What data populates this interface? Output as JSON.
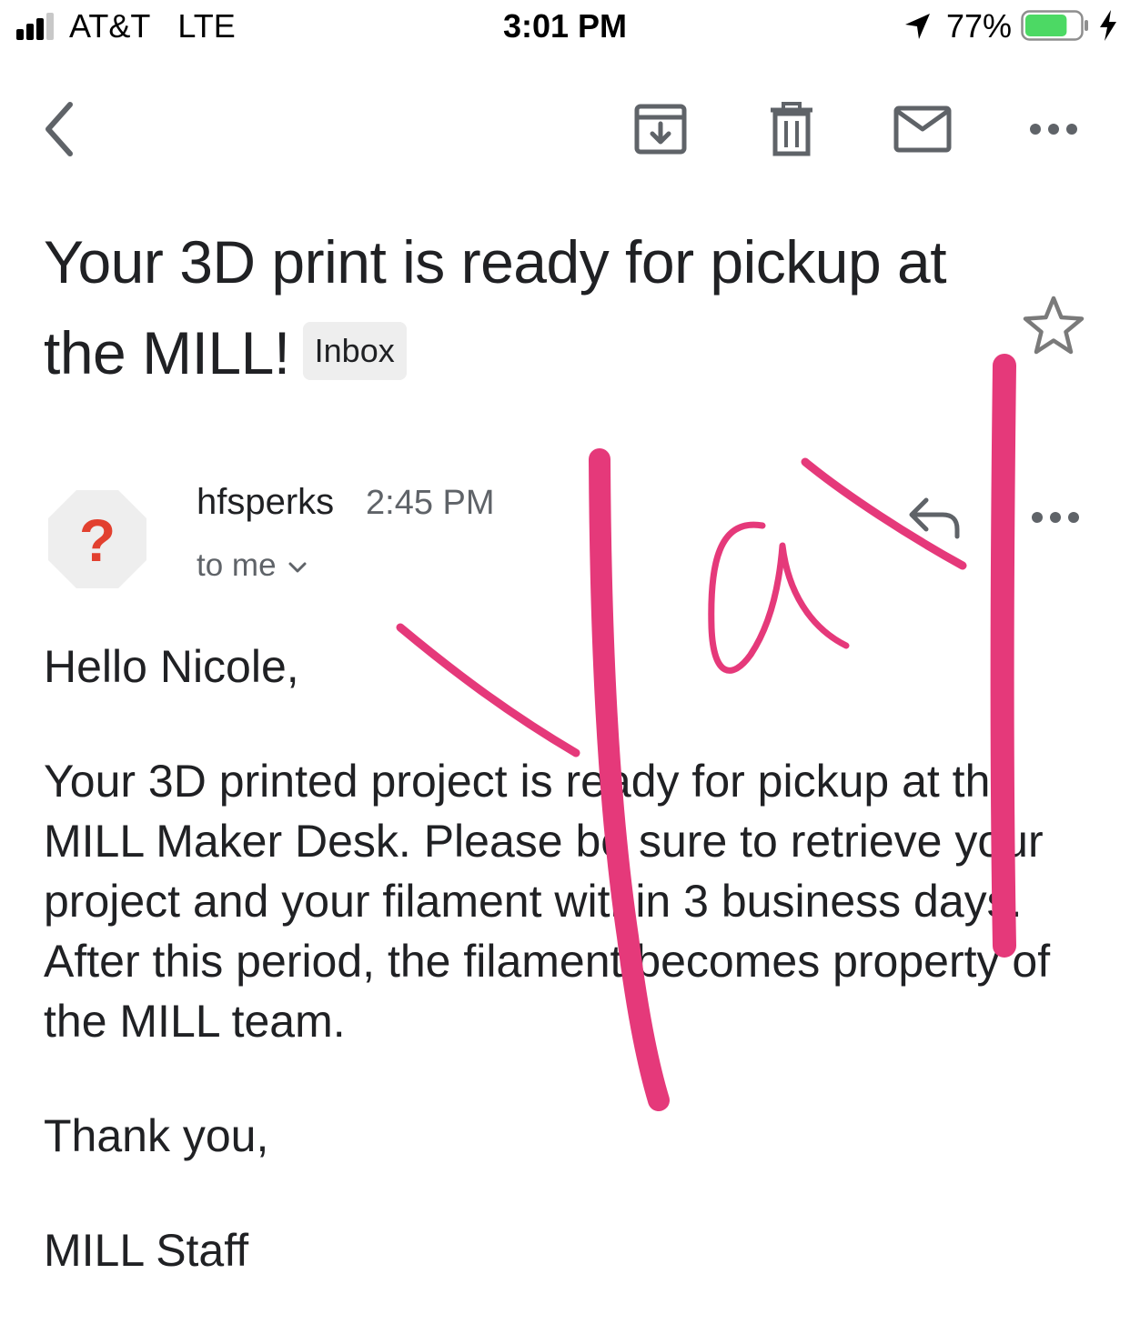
{
  "status_bar": {
    "carrier": "AT&T",
    "network": "LTE",
    "time": "3:01 PM",
    "battery_percent": "77%",
    "battery_level": 0.77,
    "battery_color": "#4cd964",
    "signal_bars_active": 3,
    "icons": [
      "signal-bars-icon",
      "location-arrow-icon",
      "battery-icon",
      "charging-bolt-icon"
    ]
  },
  "toolbar": {
    "icons": [
      "back-chevron-icon",
      "archive-icon",
      "trash-icon",
      "mark-unread-icon",
      "more-horiz-icon"
    ]
  },
  "email": {
    "subject": "Your 3D print is ready for pickup at the MILL!",
    "label_chip": "Inbox",
    "starred": false,
    "sender": {
      "name": "hfsperks",
      "time": "2:45 PM",
      "recipient": "to me",
      "avatar_icon": "question-mark-icon",
      "avatar_color": "#e2402f"
    },
    "body": {
      "greeting": "Hello Nicole,",
      "paragraph": "Your 3D printed project is ready for pickup at the MILL Maker Desk. Please be sure to retrieve your project and your filament within 3 business days. After this period, the filament becomes property of the MILL team.",
      "closing": "Thank you,",
      "signature": "MILL Staff"
    }
  },
  "annotation": {
    "ink_color": "#e5397a"
  }
}
